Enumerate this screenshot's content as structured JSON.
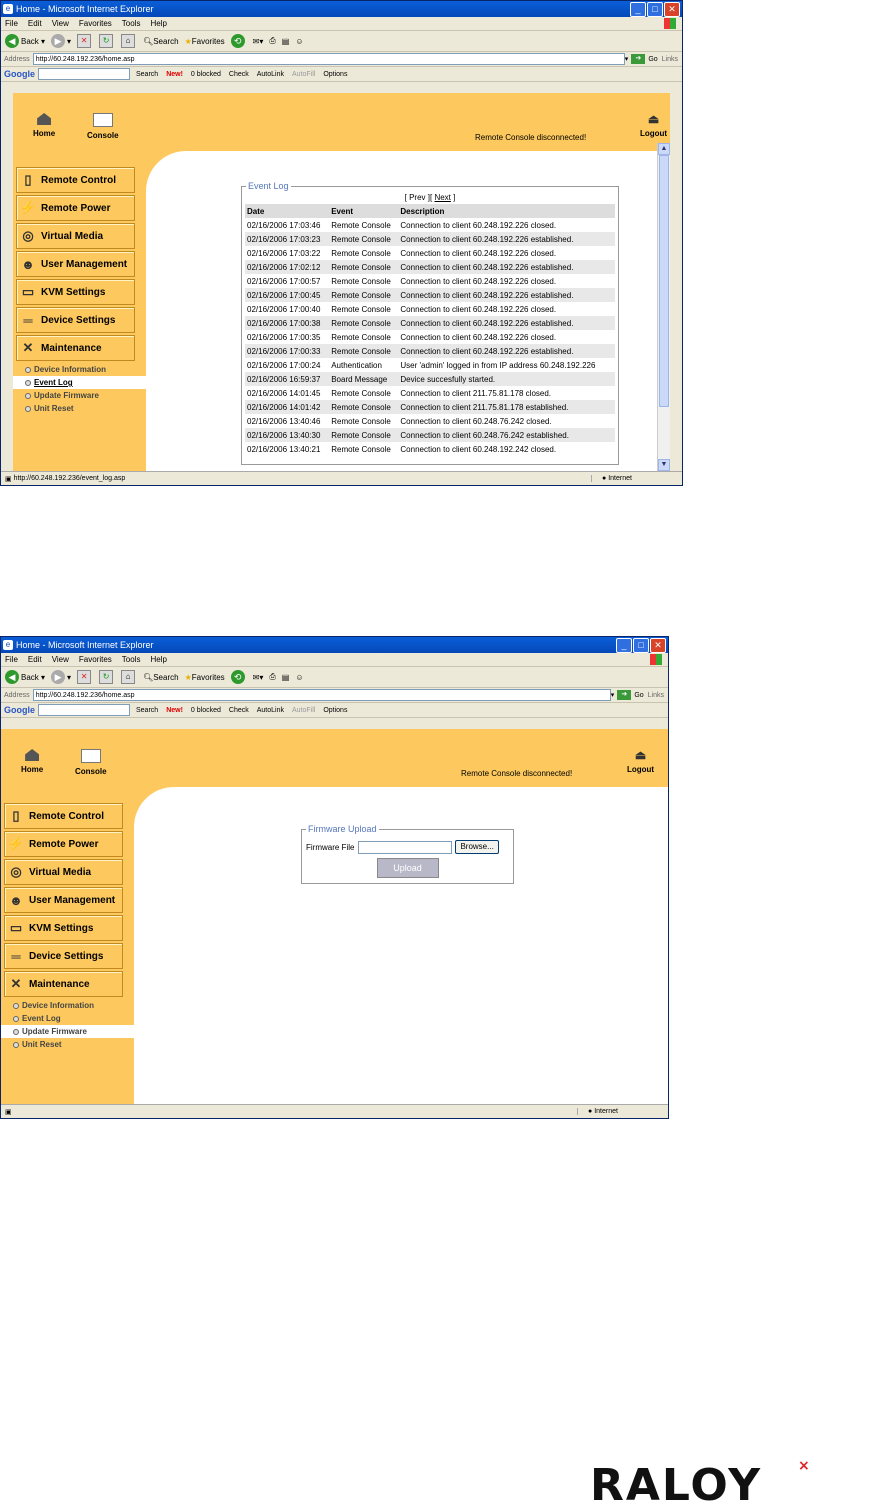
{
  "window": {
    "title": "Home - Microsoft Internet Explorer",
    "menu": [
      "File",
      "Edit",
      "View",
      "Favorites",
      "Tools",
      "Help"
    ],
    "toolbar": {
      "back": "Back",
      "search": "Search",
      "favorites": "Favorites"
    },
    "address_label": "Address",
    "go": "Go",
    "links": "Links",
    "google": {
      "logo": "Google",
      "search": "Search",
      "new": "New!",
      "blocked": "0 blocked",
      "check": "Check",
      "autolink": "AutoLink",
      "autofill": "AutoFill",
      "options": "Options"
    },
    "status_zone": "Internet"
  },
  "header": {
    "home": "Home",
    "console": "Console",
    "logout": "Logout",
    "message": "Remote Console disconnected!"
  },
  "sidebar": {
    "items": [
      "Remote Control",
      "Remote Power",
      "Virtual Media",
      "User Management",
      "KVM Settings",
      "Device Settings",
      "Maintenance"
    ],
    "subitems": [
      "Device Information",
      "Event Log",
      "Update Firmware",
      "Unit Reset"
    ]
  },
  "screen1": {
    "address": "http://60.248.192.236/home.asp",
    "status_url": "http://60.248.192.236/event_log.asp",
    "event_log": {
      "legend": "Event Log",
      "prev": "Prev",
      "next": "Next",
      "columns": [
        "Date",
        "Event",
        "Description"
      ],
      "rows": [
        [
          "02/16/2006 17:03:46",
          "Remote Console",
          "Connection to client 60.248.192.226 closed."
        ],
        [
          "02/16/2006 17:03:23",
          "Remote Console",
          "Connection to client 60.248.192.226 established."
        ],
        [
          "02/16/2006 17:03:22",
          "Remote Console",
          "Connection to client 60.248.192.226 closed."
        ],
        [
          "02/16/2006 17:02:12",
          "Remote Console",
          "Connection to client 60.248.192.226 established."
        ],
        [
          "02/16/2006 17:00:57",
          "Remote Console",
          "Connection to client 60.248.192.226 closed."
        ],
        [
          "02/16/2006 17:00:45",
          "Remote Console",
          "Connection to client 60.248.192.226 established."
        ],
        [
          "02/16/2006 17:00:40",
          "Remote Console",
          "Connection to client 60.248.192.226 closed."
        ],
        [
          "02/16/2006 17:00:38",
          "Remote Console",
          "Connection to client 60.248.192.226 established."
        ],
        [
          "02/16/2006 17:00:35",
          "Remote Console",
          "Connection to client 60.248.192.226 closed."
        ],
        [
          "02/16/2006 17:00:33",
          "Remote Console",
          "Connection to client 60.248.192.226 established."
        ],
        [
          "02/16/2006 17:00:24",
          "Authentication",
          "User 'admin' logged in from IP address 60.248.192.226"
        ],
        [
          "02/16/2006 16:59:37",
          "Board Message",
          "Device succesfully started."
        ],
        [
          "02/16/2006 14:01:45",
          "Remote Console",
          "Connection to client 211.75.81.178 closed."
        ],
        [
          "02/16/2006 14:01:42",
          "Remote Console",
          "Connection to client 211.75.81.178 established."
        ],
        [
          "02/16/2006 13:40:46",
          "Remote Console",
          "Connection to client 60.248.76.242 closed."
        ],
        [
          "02/16/2006 13:40:30",
          "Remote Console",
          "Connection to client 60.248.76.242 established."
        ],
        [
          "02/16/2006 13:40:21",
          "Remote Console",
          "Connection to client 60.248.192.242 closed."
        ]
      ]
    }
  },
  "screen2": {
    "address": "http://60.248.192.236/home.asp",
    "firmware": {
      "legend": "Firmware Upload",
      "label": "Firmware File",
      "browse": "Browse...",
      "upload": "Upload"
    }
  },
  "brand": "RALOY"
}
